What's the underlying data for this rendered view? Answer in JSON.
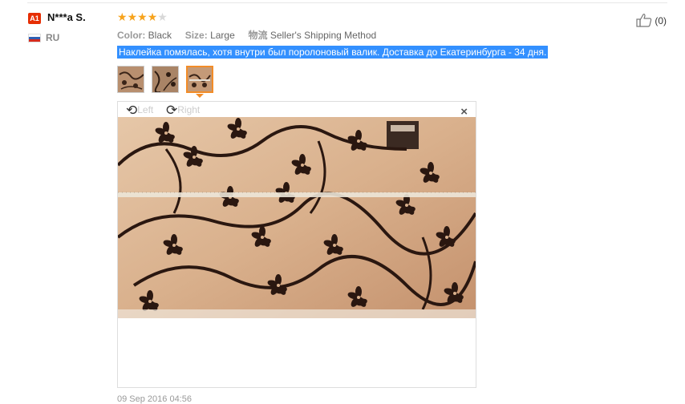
{
  "review": {
    "user": {
      "badge": "A1",
      "name": "N***a S.",
      "country": "RU"
    },
    "rating": {
      "value": 4,
      "max": 5
    },
    "meta": [
      {
        "label": "Color:",
        "value": "Black"
      },
      {
        "label": "Size:",
        "value": "Large"
      },
      {
        "label": "物流",
        "value": "Seller's Shipping Method"
      }
    ],
    "text": "Наклейка помялась, хотя внутри был поролоновый валик. Доставка до Екатеринбурга - 34 дня.",
    "thumbnails": [
      "photo-1",
      "photo-2",
      "photo-3"
    ],
    "selected_thumbnail": 3,
    "viewer": {
      "rotate_left": "Left",
      "rotate_right": "Right",
      "close": "×"
    },
    "date": "09 Sep 2016 04:56",
    "helpful": {
      "count": "(0)"
    }
  },
  "colors": {
    "badge": "#e62e04",
    "star_on": "#f7a31c",
    "star_off": "#d8d8d8",
    "selection": "#3390ff",
    "active_thumb_border": "#f28c28"
  },
  "icons": {
    "rotate_left": "rotate-left-icon",
    "rotate_right": "rotate-right-icon",
    "close": "close-icon",
    "helpful": "thumbs-up-icon"
  }
}
